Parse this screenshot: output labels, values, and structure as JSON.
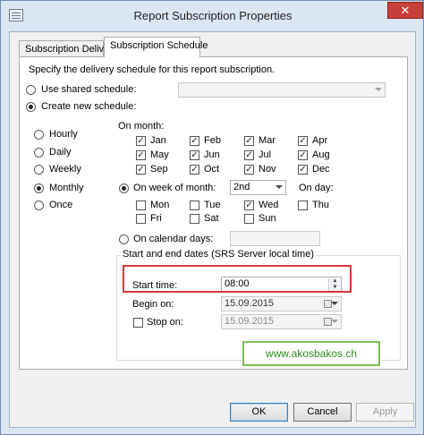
{
  "window": {
    "title": "Report Subscription Properties",
    "close_glyph": "✕"
  },
  "tabs": [
    {
      "label": "Subscription Delivery"
    },
    {
      "label": "Subscription Schedule"
    }
  ],
  "schedule": {
    "intro": "Specify the delivery schedule for this report subscription.",
    "use_shared_label": "Use shared schedule:",
    "shared_value": "",
    "create_new_label": "Create new schedule:",
    "frequencies": [
      "Hourly",
      "Daily",
      "Weekly",
      "Monthly",
      "Once"
    ],
    "selected_frequency": "Monthly",
    "on_month_label": "On month:",
    "months": [
      {
        "label": "Jan",
        "checked": true
      },
      {
        "label": "Feb",
        "checked": true
      },
      {
        "label": "Mar",
        "checked": true
      },
      {
        "label": "Apr",
        "checked": true
      },
      {
        "label": "May",
        "checked": true
      },
      {
        "label": "Jun",
        "checked": true
      },
      {
        "label": "Jul",
        "checked": true
      },
      {
        "label": "Aug",
        "checked": true
      },
      {
        "label": "Sep",
        "checked": true
      },
      {
        "label": "Oct",
        "checked": true
      },
      {
        "label": "Nov",
        "checked": true
      },
      {
        "label": "Dec",
        "checked": true
      }
    ],
    "on_week_label": "On week of month:",
    "week_value": "2nd",
    "on_day_label": "On day:",
    "days": [
      {
        "label": "Mon",
        "checked": false
      },
      {
        "label": "Tue",
        "checked": false
      },
      {
        "label": "Wed",
        "checked": true
      },
      {
        "label": "Thu",
        "checked": false
      },
      {
        "label": "Fri",
        "checked": false
      },
      {
        "label": "Sat",
        "checked": false
      },
      {
        "label": "Sun",
        "checked": false
      }
    ],
    "on_calendar_label": "On calendar days:",
    "calendar_value": ""
  },
  "dates": {
    "group_label": "Start and end dates (SRS Server local time)",
    "start_time_label": "Start time:",
    "start_time_value": "08:00",
    "begin_on_label": "Begin on:",
    "begin_on_value": "15.09.2015",
    "stop_on_label": "Stop on:",
    "stop_on_value": "15.09.2015"
  },
  "watermark": "www.akosbakos.ch",
  "buttons": {
    "ok": "OK",
    "cancel": "Cancel",
    "apply": "Apply"
  },
  "colors": {
    "highlight": "#d9383a",
    "watermark": "#2f8a1f",
    "close": "#c6403a"
  }
}
